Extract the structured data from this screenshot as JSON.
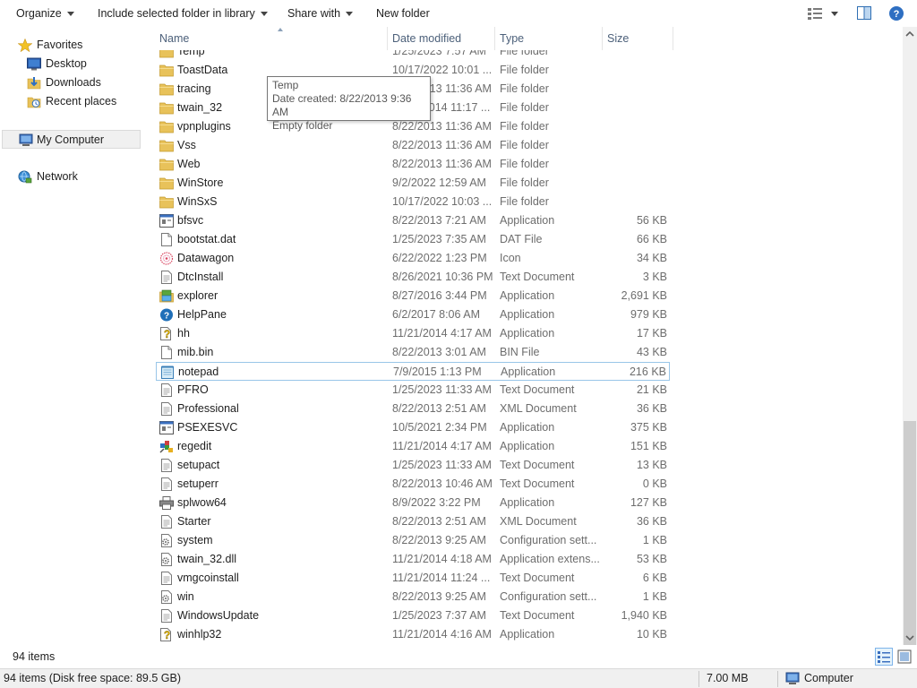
{
  "toolbar": {
    "organize": "Organize",
    "include": "Include selected folder in library",
    "share": "Share with",
    "new_folder": "New folder"
  },
  "nav": {
    "favorites": "Favorites",
    "desktop": "Desktop",
    "downloads": "Downloads",
    "recent": "Recent places",
    "my_computer": "My Computer",
    "network": "Network"
  },
  "columns": {
    "name": "Name",
    "date": "Date modified",
    "type": "Type",
    "size": "Size"
  },
  "files": [
    {
      "name": "Temp",
      "date": "1/25/2023 7:57 AM",
      "type": "File folder",
      "size": "",
      "icon": "folder"
    },
    {
      "name": "ToastData",
      "date": "10/17/2022 10:01 ...",
      "type": "File folder",
      "size": "",
      "icon": "folder"
    },
    {
      "name": "tracing",
      "date": "8/22/2013 11:36 AM",
      "type": "File folder",
      "size": "",
      "icon": "folder"
    },
    {
      "name": "twain_32",
      "date": "11/21/2014 11:17 ...",
      "type": "File folder",
      "size": "",
      "icon": "folder"
    },
    {
      "name": "vpnplugins",
      "date": "8/22/2013 11:36 AM",
      "type": "File folder",
      "size": "",
      "icon": "folder"
    },
    {
      "name": "Vss",
      "date": "8/22/2013 11:36 AM",
      "type": "File folder",
      "size": "",
      "icon": "folder"
    },
    {
      "name": "Web",
      "date": "8/22/2013 11:36 AM",
      "type": "File folder",
      "size": "",
      "icon": "folder"
    },
    {
      "name": "WinStore",
      "date": "9/2/2022 12:59 AM",
      "type": "File folder",
      "size": "",
      "icon": "folder"
    },
    {
      "name": "WinSxS",
      "date": "10/17/2022 10:03 ...",
      "type": "File folder",
      "size": "",
      "icon": "folder"
    },
    {
      "name": "bfsvc",
      "date": "8/22/2013 7:21 AM",
      "type": "Application",
      "size": "56 KB",
      "icon": "app"
    },
    {
      "name": "bootstat.dat",
      "date": "1/25/2023 7:35 AM",
      "type": "DAT File",
      "size": "66 KB",
      "icon": "file"
    },
    {
      "name": "Datawagon",
      "date": "6/22/2022 1:23 PM",
      "type": "Icon",
      "size": "34 KB",
      "icon": "flower"
    },
    {
      "name": "DtcInstall",
      "date": "8/26/2021 10:36 PM",
      "type": "Text Document",
      "size": "3 KB",
      "icon": "text"
    },
    {
      "name": "explorer",
      "date": "8/27/2016 3:44 PM",
      "type": "Application",
      "size": "2,691 KB",
      "icon": "explorer"
    },
    {
      "name": "HelpPane",
      "date": "6/2/2017 8:06 AM",
      "type": "Application",
      "size": "979 KB",
      "icon": "help"
    },
    {
      "name": "hh",
      "date": "11/21/2014 4:17 AM",
      "type": "Application",
      "size": "17 KB",
      "icon": "hh"
    },
    {
      "name": "mib.bin",
      "date": "8/22/2013 3:01 AM",
      "type": "BIN File",
      "size": "43 KB",
      "icon": "file"
    },
    {
      "name": "notepad",
      "date": "7/9/2015 1:13 PM",
      "type": "Application",
      "size": "216 KB",
      "icon": "notepad"
    },
    {
      "name": "PFRO",
      "date": "1/25/2023 11:33 AM",
      "type": "Text Document",
      "size": "21 KB",
      "icon": "text"
    },
    {
      "name": "Professional",
      "date": "8/22/2013 2:51 AM",
      "type": "XML Document",
      "size": "36 KB",
      "icon": "text"
    },
    {
      "name": "PSEXESVC",
      "date": "10/5/2021 2:34 PM",
      "type": "Application",
      "size": "375 KB",
      "icon": "app"
    },
    {
      "name": "regedit",
      "date": "11/21/2014 4:17 AM",
      "type": "Application",
      "size": "151 KB",
      "icon": "regedit"
    },
    {
      "name": "setupact",
      "date": "1/25/2023 11:33 AM",
      "type": "Text Document",
      "size": "13 KB",
      "icon": "text"
    },
    {
      "name": "setuperr",
      "date": "8/22/2013 10:46 AM",
      "type": "Text Document",
      "size": "0 KB",
      "icon": "text"
    },
    {
      "name": "splwow64",
      "date": "8/9/2022 3:22 PM",
      "type": "Application",
      "size": "127 KB",
      "icon": "printer"
    },
    {
      "name": "Starter",
      "date": "8/22/2013 2:51 AM",
      "type": "XML Document",
      "size": "36 KB",
      "icon": "text"
    },
    {
      "name": "system",
      "date": "8/22/2013 9:25 AM",
      "type": "Configuration sett...",
      "size": "1 KB",
      "icon": "config"
    },
    {
      "name": "twain_32.dll",
      "date": "11/21/2014 4:18 AM",
      "type": "Application extens...",
      "size": "53 KB",
      "icon": "config"
    },
    {
      "name": "vmgcoinstall",
      "date": "11/21/2014 11:24 ...",
      "type": "Text Document",
      "size": "6 KB",
      "icon": "text"
    },
    {
      "name": "win",
      "date": "8/22/2013 9:25 AM",
      "type": "Configuration sett...",
      "size": "1 KB",
      "icon": "config"
    },
    {
      "name": "WindowsUpdate",
      "date": "1/25/2023 7:37 AM",
      "type": "Text Document",
      "size": "1,940 KB",
      "icon": "text"
    },
    {
      "name": "winhlp32",
      "date": "11/21/2014 4:16 AM",
      "type": "Application",
      "size": "10 KB",
      "icon": "hh"
    }
  ],
  "tooltip": {
    "line1": "Temp",
    "line2": "Date created: 8/22/2013 9:36 AM",
    "line3": "Empty folder"
  },
  "details": {
    "item_count": "94 items"
  },
  "status": {
    "items": "94 items (Disk free space: 89.5 GB)",
    "size": "7.00 MB",
    "location": "Computer"
  },
  "colors": {
    "folder": "#e8c25a",
    "hover_border": "#99c6e8",
    "header_text": "#4c607a"
  }
}
